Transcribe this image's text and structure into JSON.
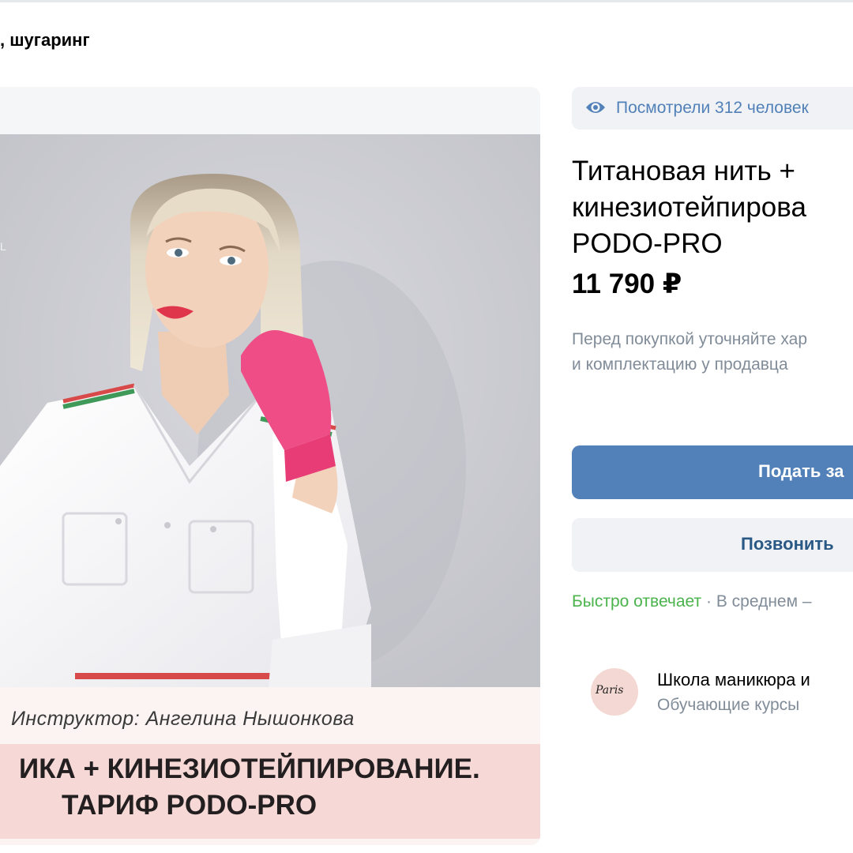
{
  "header": {
    "breadcrumb_fragment": ", шугаринг"
  },
  "product": {
    "views_text": "Посмотрели 312 человек",
    "title_lines": [
      "Титановая нить +",
      "кинезиотейпирова",
      "PODO-PRO"
    ],
    "price": "11 790 ₽",
    "disclaimer_lines": [
      "Перед покупкой уточняйте хар",
      "и комплектацию у продавца"
    ],
    "primary_button_label": "Подать за",
    "call_button_label": "Позвонить",
    "response_fast": "Быстро отвечает",
    "response_separator": " · ",
    "response_avg": "В среднем –"
  },
  "media": {
    "watermark": "L",
    "instructor_caption": "Инструктор: Ангелина Нышонкова",
    "course_title_lines": [
      "ИКА + КИНЕЗИОТЕЙПИРОВАНИЕ.",
      "ТАРИФ PODO-PRO"
    ]
  },
  "seller": {
    "avatar_text": "Paris",
    "name": "Школа маникюра и",
    "category": "Обучающие курсы"
  },
  "colors": {
    "accent": "#5181b8",
    "secondary_link": "#2a5885",
    "muted_text": "#818c99",
    "positive": "#4bb34b",
    "button_secondary_bg": "#f0f2f5",
    "caption_band": "#f6d9d6"
  },
  "icons": {
    "views": "eye-icon"
  }
}
